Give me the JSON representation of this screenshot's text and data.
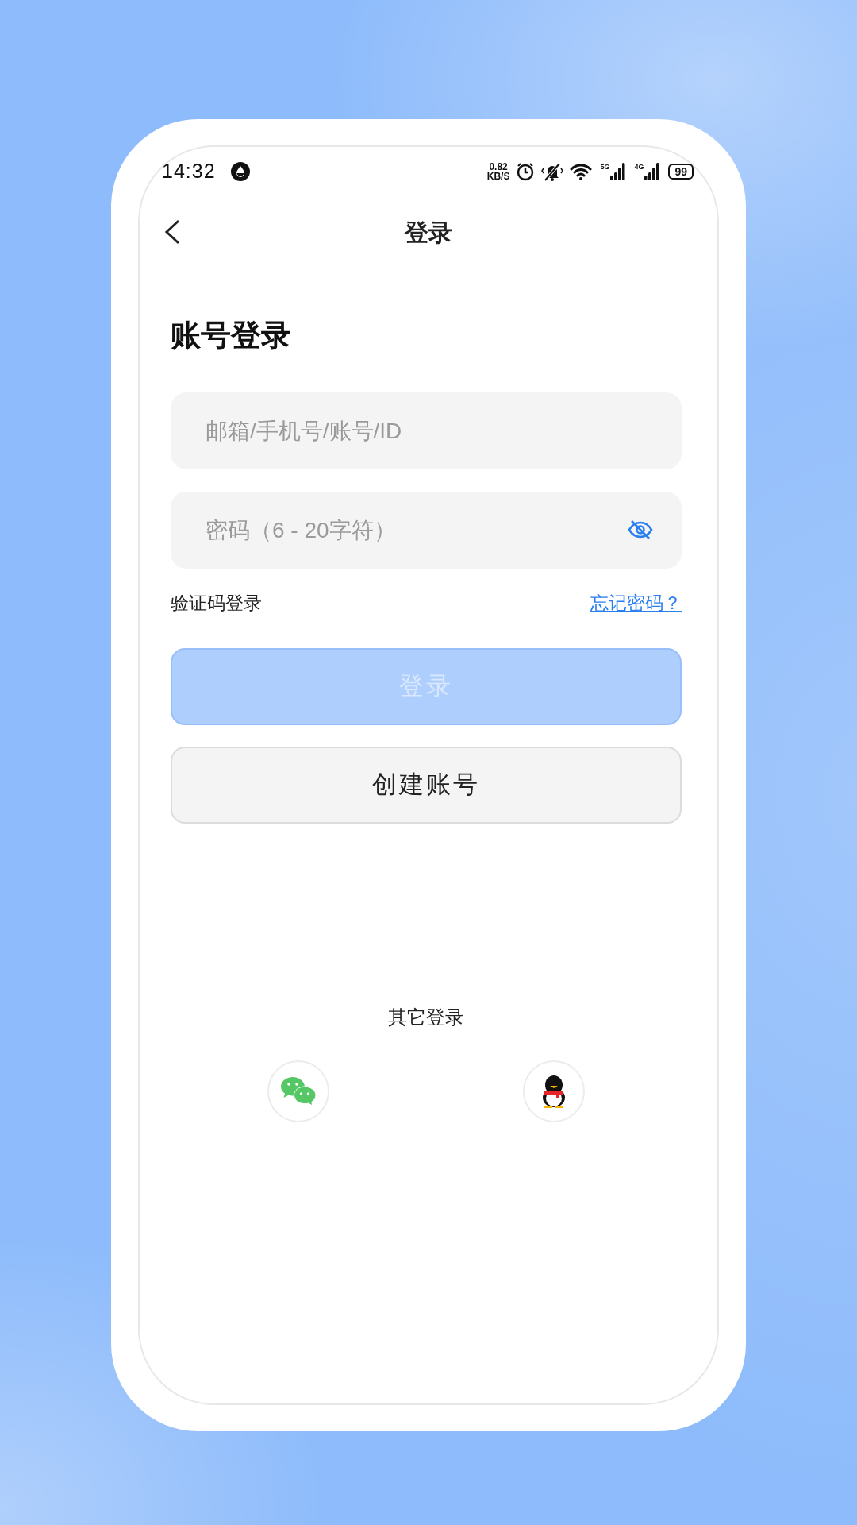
{
  "status_bar": {
    "time": "14:32",
    "speed_value": "0.82",
    "speed_unit": "KB/S",
    "signals": [
      {
        "label": "5G"
      },
      {
        "label": "4G"
      }
    ],
    "battery": "99"
  },
  "nav": {
    "title": "登录"
  },
  "heading": "账号登录",
  "fields": [
    {
      "placeholder": "邮箱/手机号/账号/ID",
      "kind": "text"
    },
    {
      "placeholder": "密码（6 - 20字符）",
      "kind": "password"
    }
  ],
  "links": {
    "left": "验证码登录",
    "right": "忘记密码？"
  },
  "buttons": [
    {
      "label": "登录",
      "kind": "primary",
      "disabled": true
    },
    {
      "label": "创建账号",
      "kind": "secondary",
      "disabled": false
    }
  ],
  "other_login": {
    "title": "其它登录",
    "options": [
      {
        "kind": "wechat"
      },
      {
        "kind": "qq"
      }
    ]
  }
}
